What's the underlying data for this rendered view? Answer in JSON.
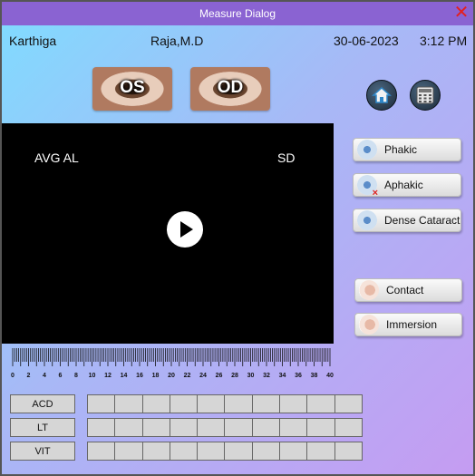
{
  "window": {
    "title": "Measure Dialog",
    "close_label": "✕"
  },
  "patient": {
    "name": "Karthiga",
    "doctor": "Raja,M.D",
    "date": "30-06-2023",
    "time": "3:12 PM"
  },
  "eyes": {
    "left_label": "OS",
    "right_label": "OD"
  },
  "video": {
    "avg_label": "AVG AL",
    "sd_label": "SD"
  },
  "modes": {
    "phakic": "Phakic",
    "aphakic": "Aphakic",
    "dense_cataract": "Dense Cataract",
    "contact": "Contact",
    "immersion": "Immersion"
  },
  "ruler": {
    "ticks": [
      "0",
      "2",
      "4",
      "6",
      "8",
      "10",
      "12",
      "14",
      "16",
      "18",
      "20",
      "22",
      "24",
      "26",
      "28",
      "30",
      "32",
      "34",
      "36",
      "38",
      "40"
    ]
  },
  "rows": [
    {
      "label": "ACD"
    },
    {
      "label": "LT"
    },
    {
      "label": "VIT"
    }
  ],
  "icons": {
    "home": "home-icon",
    "calculator": "calculator-icon",
    "play": "play-icon"
  }
}
